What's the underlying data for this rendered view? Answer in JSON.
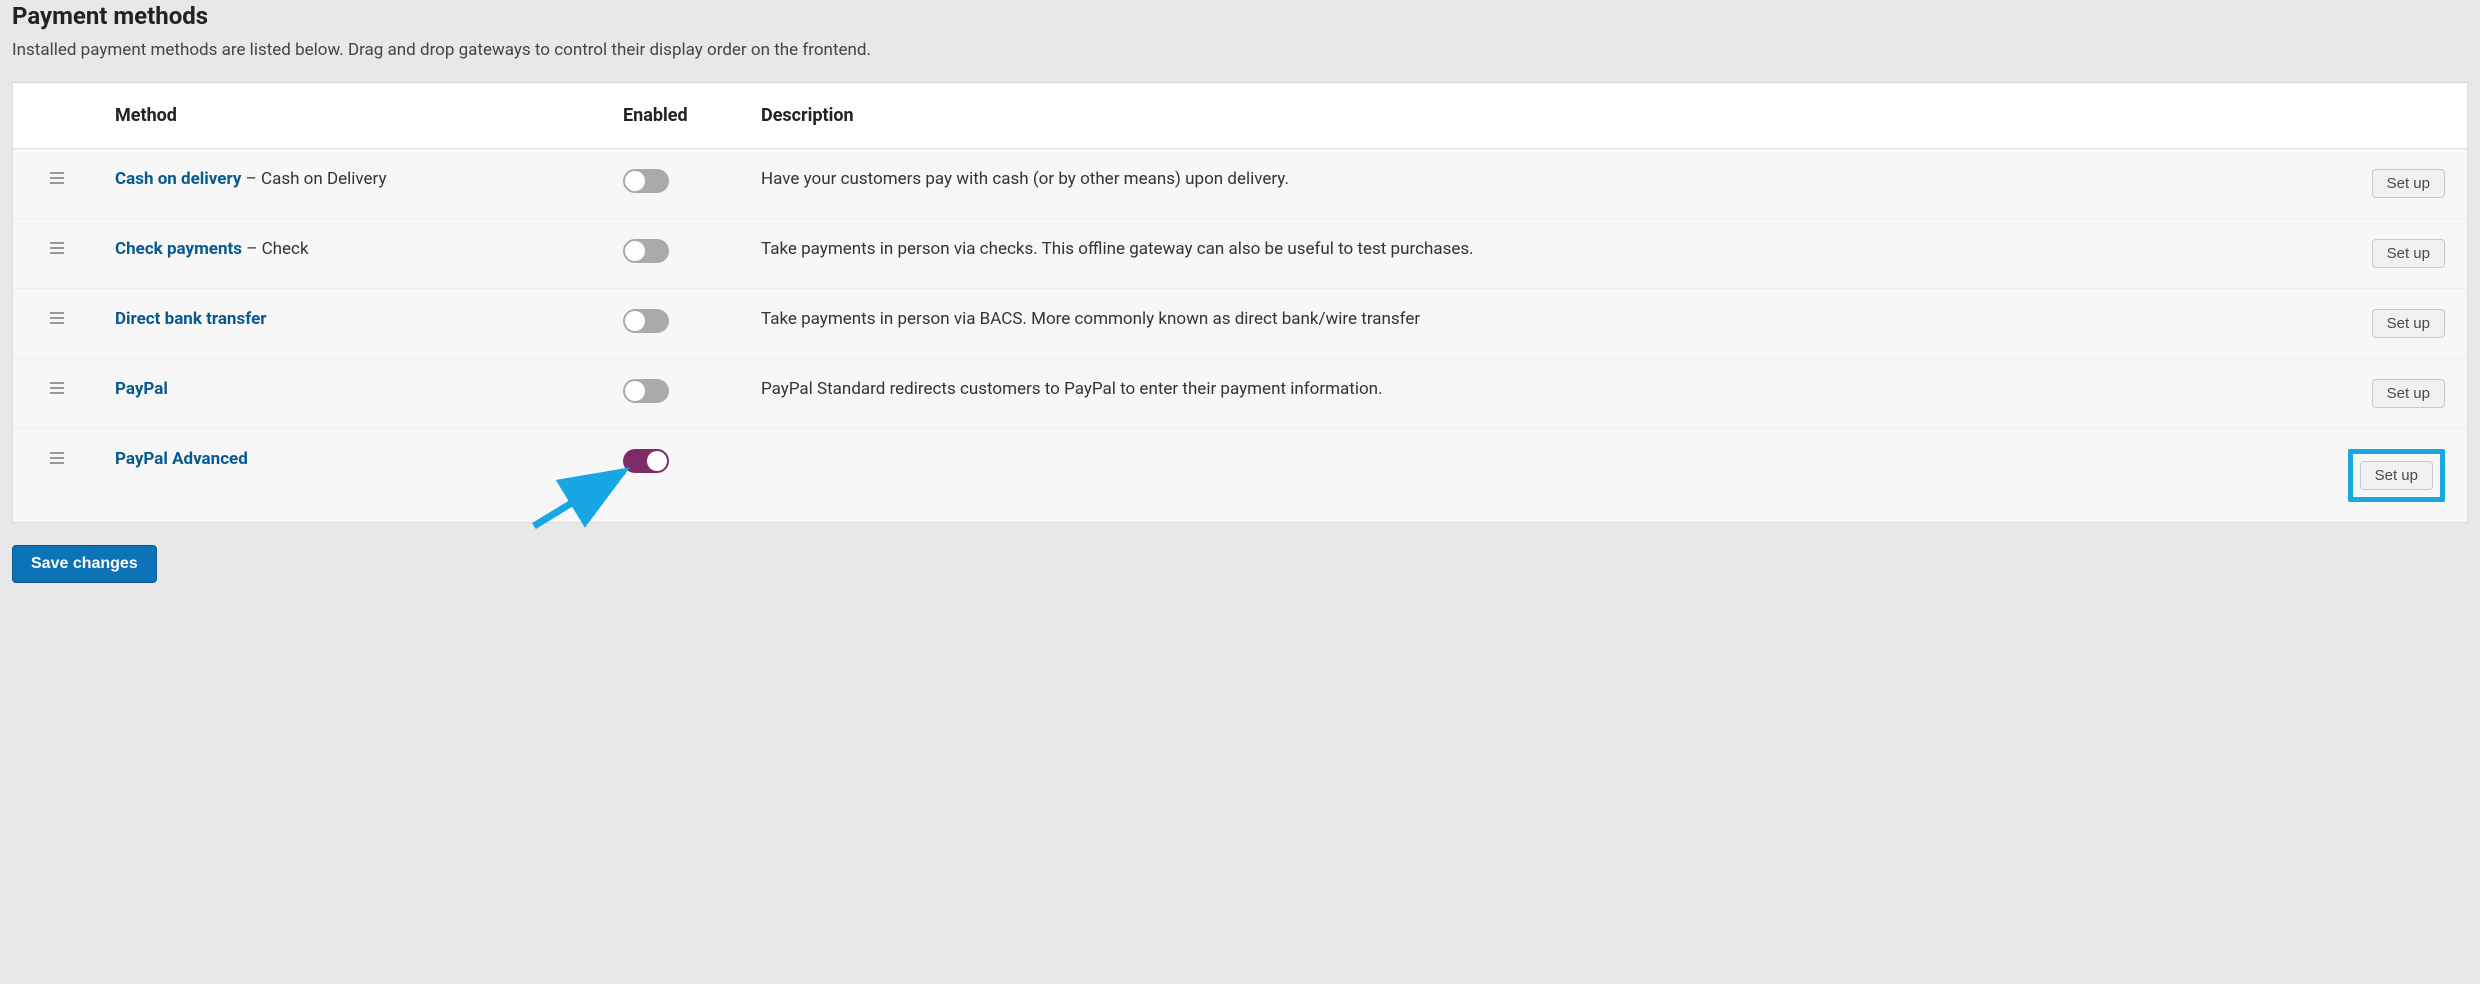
{
  "section": {
    "title": "Payment methods",
    "description": "Installed payment methods are listed below. Drag and drop gateways to control their display order on the frontend."
  },
  "columns": {
    "method": "Method",
    "enabled": "Enabled",
    "description": "Description"
  },
  "rows": [
    {
      "name": "Cash on delivery",
      "suffix": " – Cash on Delivery",
      "enabled": false,
      "description": "Have your customers pay with cash (or by other means) upon delivery.",
      "action": "Set up",
      "highlight": false
    },
    {
      "name": "Check payments",
      "suffix": " – Check",
      "enabled": false,
      "description": "Take payments in person via checks. This offline gateway can also be useful to test purchases.",
      "action": "Set up",
      "highlight": false
    },
    {
      "name": "Direct bank transfer",
      "suffix": "",
      "enabled": false,
      "description": "Take payments in person via BACS. More commonly known as direct bank/wire transfer",
      "action": "Set up",
      "highlight": false
    },
    {
      "name": "PayPal",
      "suffix": "",
      "enabled": false,
      "description": "PayPal Standard redirects customers to PayPal to enter their payment information.",
      "action": "Set up",
      "highlight": false
    },
    {
      "name": "PayPal Advanced",
      "suffix": "",
      "enabled": true,
      "description": "",
      "action": "Set up",
      "highlight": true
    }
  ],
  "buttons": {
    "save": "Save changes"
  },
  "colors": {
    "link": "#065A8F",
    "toggle_on": "#7f2b68",
    "highlight": "#17a8e3",
    "primary_btn": "#0c73b8"
  }
}
